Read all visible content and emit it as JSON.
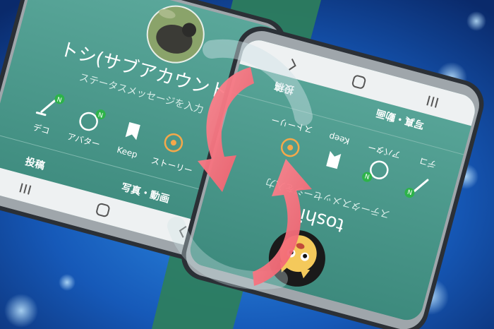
{
  "colors": {
    "background_dark": "#0a2a6b",
    "background_light": "#1f78d0",
    "stripe_green": "#2f7f5a",
    "screen_teal": "#3f8f82",
    "screen_teal_light": "#5aa79a",
    "nav_bar": "#eef1f2",
    "arrow_pink": "#f56b78",
    "badge_green": "#2db34a"
  },
  "left_phone": {
    "profile_name": "トシ(サブアカウント)",
    "status_message": "ステータスメッセージを入力",
    "actions": [
      {
        "label": "デコ",
        "icon": "pen-icon",
        "badge": "N"
      },
      {
        "label": "アバター",
        "icon": "avatar-icon",
        "badge": "N"
      },
      {
        "label": "Keep",
        "icon": "bookmark-icon",
        "badge": ""
      },
      {
        "label": "ストーリー",
        "icon": "story-icon",
        "badge": ""
      }
    ],
    "tabs": [
      {
        "label": "投稿"
      },
      {
        "label": "写真・動画"
      }
    ],
    "avatar_icon": "dog-photo-icon",
    "nav_icons": [
      "recent-apps-icon",
      "home-icon",
      "back-icon"
    ]
  },
  "right_phone": {
    "profile_name": "toshi",
    "status_message": "ステータスメッセージを入力",
    "actions": [
      {
        "label": "デコ",
        "icon": "pen-icon",
        "badge": "N"
      },
      {
        "label": "アバター",
        "icon": "avatar-icon",
        "badge": "N"
      },
      {
        "label": "Keep",
        "icon": "bookmark-icon",
        "badge": ""
      },
      {
        "label": "ストーリー",
        "icon": "story-icon",
        "badge": ""
      }
    ],
    "tabs": [
      {
        "label": "投稿"
      },
      {
        "label": "写真・動画"
      }
    ],
    "avatar_icon": "cat-avatar-icon",
    "nav_icons": [
      "back-icon",
      "home-icon",
      "recent-apps-icon"
    ]
  }
}
